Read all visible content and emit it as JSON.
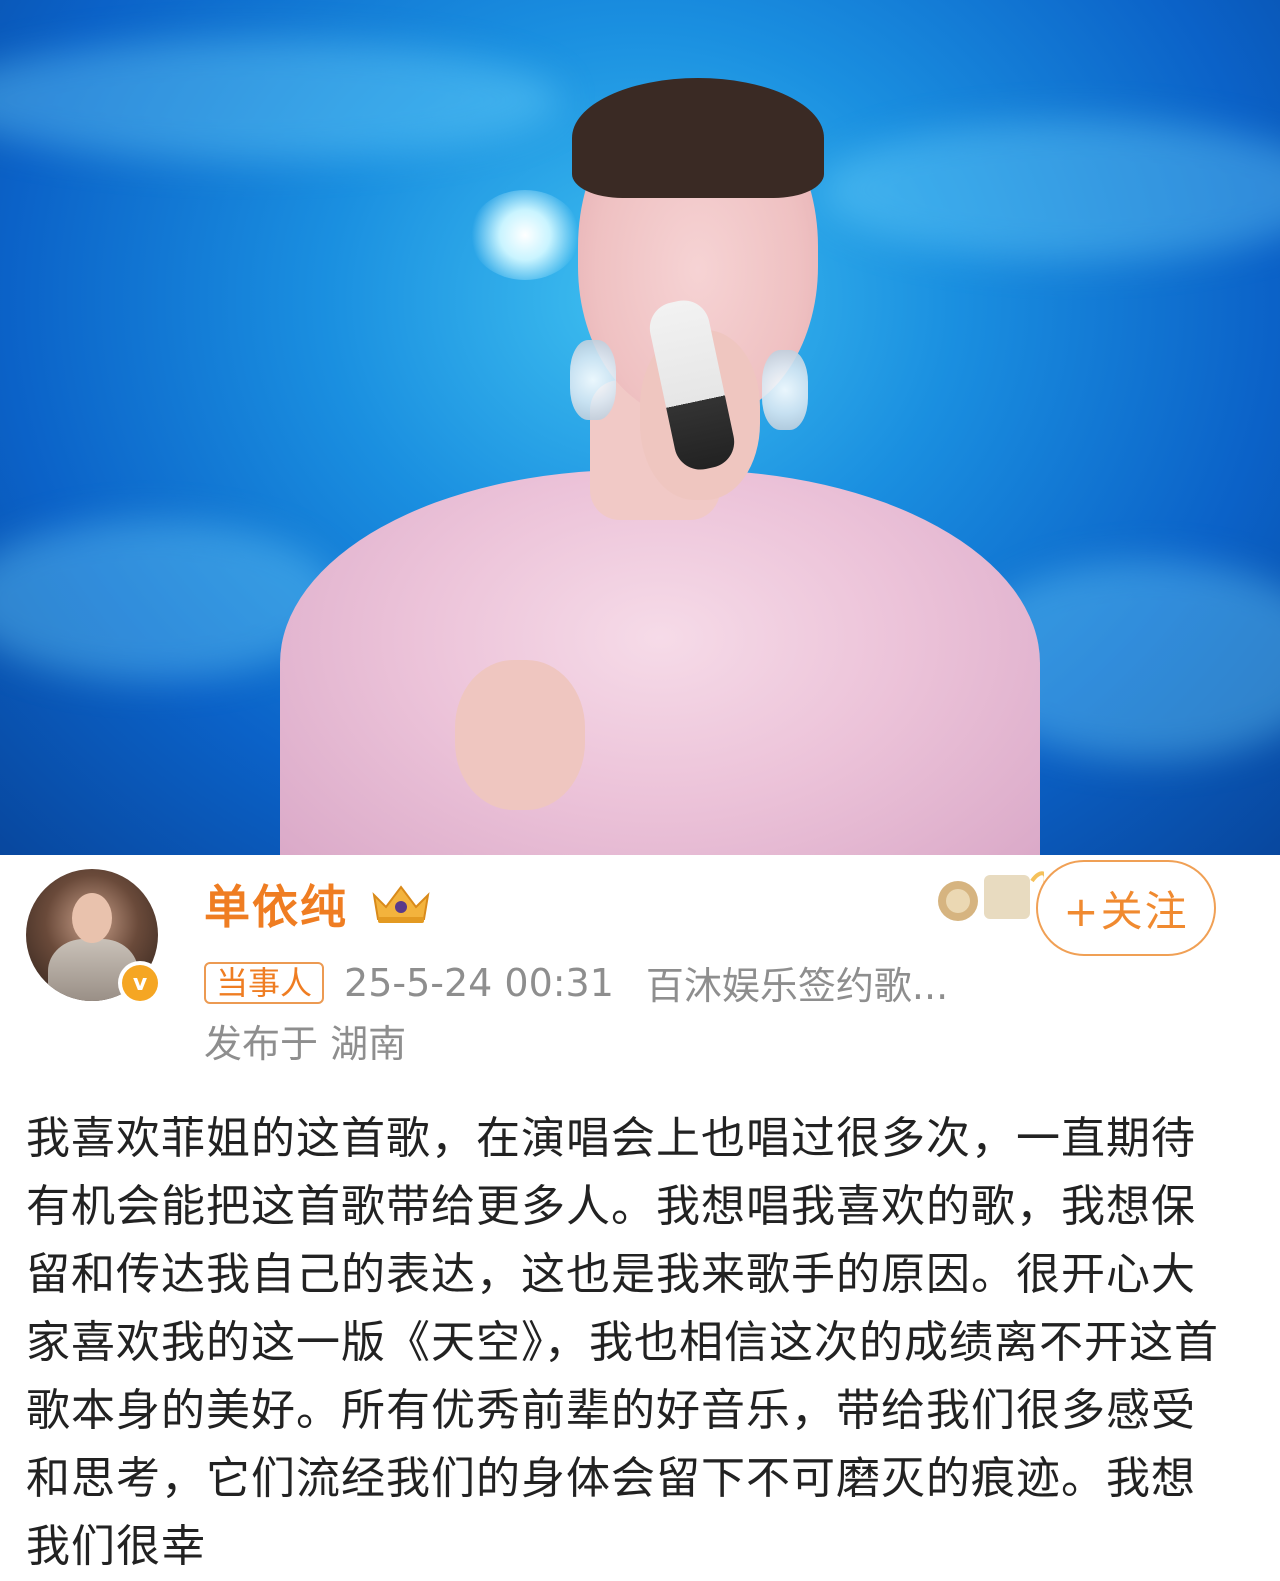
{
  "post": {
    "author": {
      "name": "单依纯",
      "verified_icon": "v-verified-icon",
      "level_icon": "crown-icon"
    },
    "follow_label": "+关注",
    "tag": "当事人",
    "timestamp": "25-5-24 00:31",
    "source": "百沐娱乐签约歌...",
    "location": "发布于 湖南",
    "body": "我喜欢菲姐的这首歌，在演唱会上也唱过很多次，一直期待有机会能把这首歌带给更多人。我想唱我喜欢的歌，我想保留和传达我自己的表达，这也是我来歌手的原因。很开心大家喜欢我的这一版《天空》，我也相信这次的成绩离不开这首歌本身的美好。所有优秀前辈的好音乐，带给我们很多感受和思考，它们流经我们的身体会留下不可磨灭的痕迹。我想我们很幸"
  },
  "colors": {
    "accent": "#ef7d22",
    "meta_text": "#8e8e8e",
    "body_text": "#222222"
  }
}
